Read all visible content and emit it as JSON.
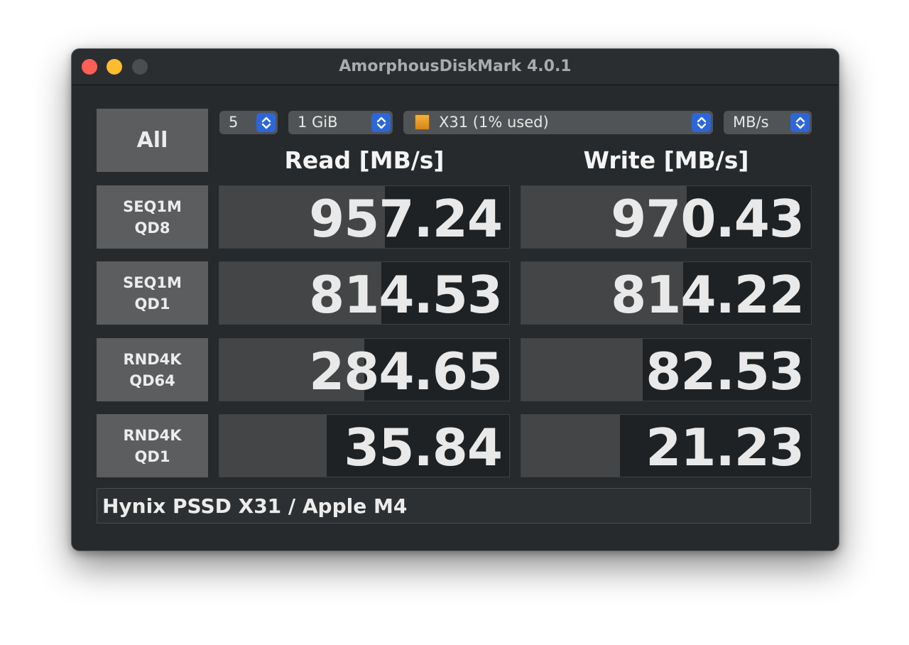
{
  "window": {
    "title": "AmorphousDiskMark 4.0.1"
  },
  "controls": {
    "all_label": "All",
    "count": "5",
    "size": "1 GiB",
    "drive": "X31 (1% used)",
    "unit": "MB/s"
  },
  "headers": {
    "read": "Read [MB/s]",
    "write": "Write [MB/s]"
  },
  "tests": [
    {
      "line1": "SEQ1M",
      "line2": "QD8",
      "read": "957.24",
      "write": "970.43",
      "read_bar": 0.57,
      "write_bar": 0.57
    },
    {
      "line1": "SEQ1M",
      "line2": "QD1",
      "read": "814.53",
      "write": "814.22",
      "read_bar": 0.56,
      "write_bar": 0.56
    },
    {
      "line1": "RND4K",
      "line2": "QD64",
      "read": "284.65",
      "write": "82.53",
      "read_bar": 0.5,
      "write_bar": 0.42
    },
    {
      "line1": "RND4K",
      "line2": "QD1",
      "read": "35.84",
      "write": "21.23",
      "read_bar": 0.37,
      "write_bar": 0.34
    }
  ],
  "comment": "Hynix PSSD X31 / Apple M4",
  "colors": {
    "close": "#fe5f57",
    "minimize": "#febc2e",
    "zoom_disabled": "#4b4e51",
    "stepper": "#2d66d8",
    "bar_fill": "#434547",
    "cell_bg": "#1f2224"
  }
}
